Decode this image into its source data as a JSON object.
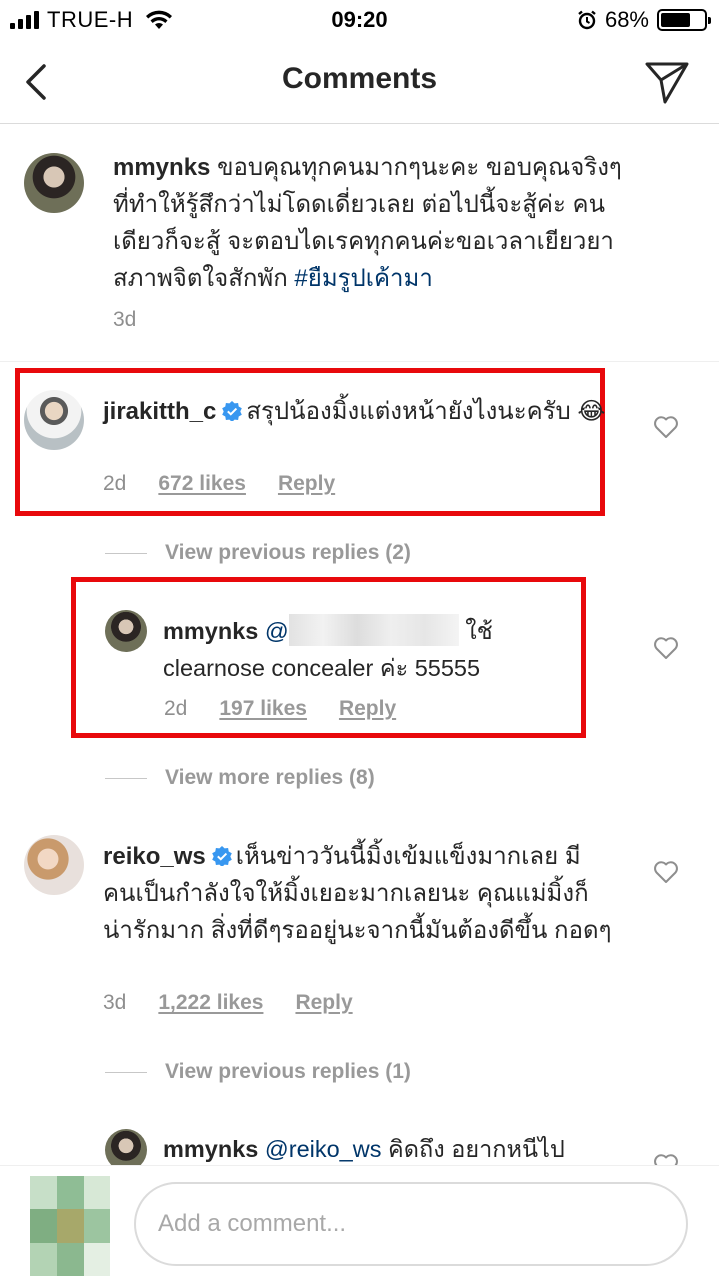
{
  "status_bar": {
    "carrier": "TRUE-H",
    "time": "09:20",
    "battery": "68%",
    "battery_level": 0.68
  },
  "header": {
    "title": "Comments"
  },
  "comments": [
    {
      "username": "mmynks",
      "text": "ขอบคุณทุกคนมากๆนะคะ ขอบคุณจริงๆที่ทำให้รู้สึกว่าไม่โดดเดี่ยวเลย ต่อไปนี้จะสู้ค่ะ คนเดียวก็จะสู้ จะตอบไดเรคทุกคนค่ะขอเวลาเยียวยาสภาพจิตใจสักพัก",
      "hashtag": "#ยืมรูปเค้ามา",
      "time": "3d"
    },
    {
      "username": "jirakitth_c",
      "text": "สรุปน้องมิ้งแต่งหน้ายังไงนะครับ 😂",
      "time": "2d",
      "likes": "672 likes",
      "reply_label": "Reply"
    },
    {
      "username": "reiko_ws",
      "text": "เห็นข่าววันนี้มิ้งเข้มแข็งมากเลย มีคนเป็นกำลังใจให้มิ้งเยอะมากเลยนะ คุณแม่มิ้งก็น่ารักมาก สิ่งที่ดีๆรออยู่นะจากนี้มันต้องดีขึ้น กอดๆ",
      "time": "3d",
      "likes": "1,222 likes",
      "reply_label": "Reply"
    }
  ],
  "replies": [
    {
      "username": "mmynks",
      "mention": "@",
      "text": "ใช้ clearnose concealer ค่ะ 55555",
      "time": "2d",
      "likes": "197 likes",
      "reply_label": "Reply"
    },
    {
      "username": "mmynks",
      "mention": "@reiko_ws",
      "text": "คิดถึง อยากหนีไป"
    }
  ],
  "view_replies": [
    "View previous replies (2)",
    "View more replies (8)",
    "View previous replies (1)"
  ],
  "composer": {
    "placeholder": "Add a comment..."
  },
  "colors": {
    "highlight": "#e8090c",
    "hashtag": "#003569",
    "verified": "#3897f0"
  }
}
